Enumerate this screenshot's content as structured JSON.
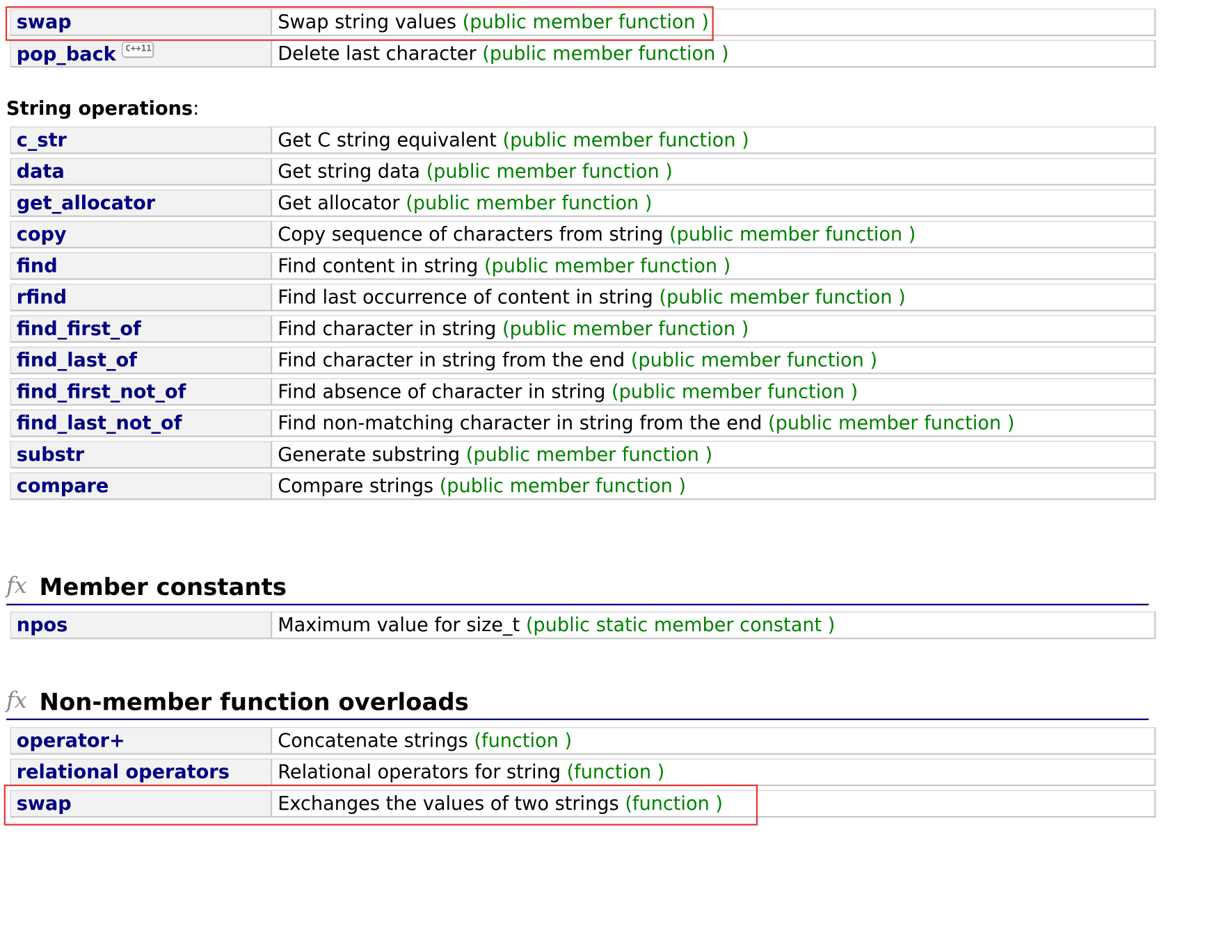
{
  "tables": {
    "modifiers_tail": [
      {
        "name": "swap",
        "desc": "Swap string values",
        "kind": "(public member function )",
        "badge": ""
      },
      {
        "name": "pop_back",
        "desc": "Delete last character",
        "kind": "(public member function )",
        "badge": "C++11"
      }
    ],
    "string_operations": [
      {
        "name": "c_str",
        "desc": "Get C string equivalent",
        "kind": "(public member function )"
      },
      {
        "name": "data",
        "desc": "Get string data",
        "kind": "(public member function )"
      },
      {
        "name": "get_allocator",
        "desc": "Get allocator",
        "kind": "(public member function )"
      },
      {
        "name": "copy",
        "desc": "Copy sequence of characters from string",
        "kind": "(public member function )"
      },
      {
        "name": "find",
        "desc": "Find content in string",
        "kind": "(public member function )"
      },
      {
        "name": "rfind",
        "desc": "Find last occurrence of content in string",
        "kind": "(public member function )"
      },
      {
        "name": "find_first_of",
        "desc": "Find character in string",
        "kind": "(public member function )"
      },
      {
        "name": "find_last_of",
        "desc": "Find character in string from the end",
        "kind": "(public member function )"
      },
      {
        "name": "find_first_not_of",
        "desc": "Find absence of character in string",
        "kind": "(public member function )"
      },
      {
        "name": "find_last_not_of",
        "desc": "Find non-matching character in string from the end",
        "kind": "(public member function )"
      },
      {
        "name": "substr",
        "desc": "Generate substring",
        "kind": "(public member function )"
      },
      {
        "name": "compare",
        "desc": "Compare strings",
        "kind": "(public member function )"
      }
    ],
    "member_constants": [
      {
        "name": "npos",
        "desc": "Maximum value for size_t",
        "kind": "(public static member constant )"
      }
    ],
    "non_member": [
      {
        "name": "operator+",
        "desc": "Concatenate strings",
        "kind": "(function )"
      },
      {
        "name": "relational operators",
        "desc": "Relational operators for string",
        "kind": "(function )"
      },
      {
        "name": "swap",
        "desc": "Exchanges the values of two strings",
        "kind": "(function )"
      }
    ]
  },
  "headings": {
    "string_operations": "String operations",
    "string_operations_colon": ":",
    "member_constants": "Member constants",
    "non_member": "Non-member function overloads",
    "fx_glyph": "fx"
  },
  "icons": {
    "section": "function-fx-icon",
    "version": "cpp11-badge-icon"
  },
  "colors": {
    "link": "#000080",
    "kind": "#008000",
    "highlight": "#e53935",
    "section_rule": "#000080"
  }
}
